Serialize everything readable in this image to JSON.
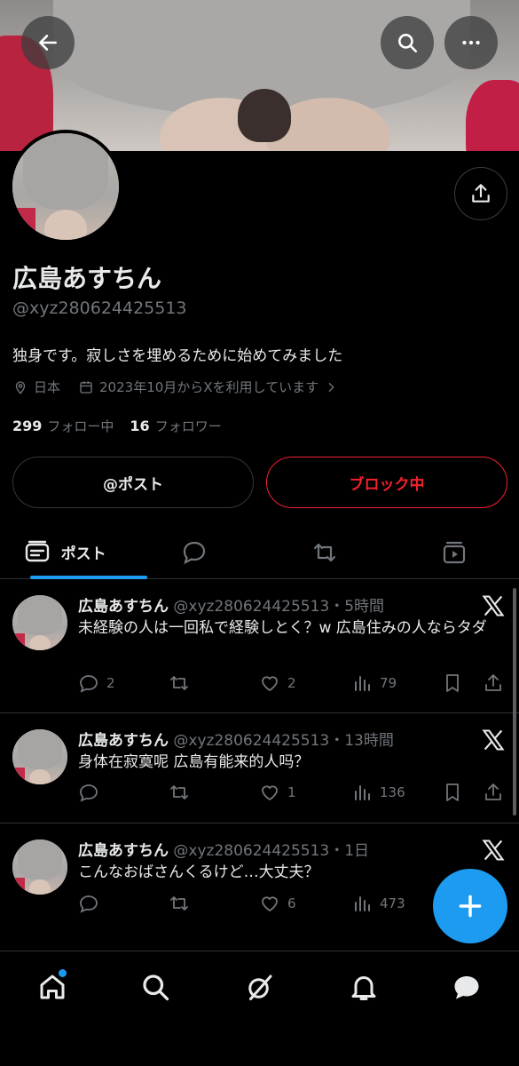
{
  "profile": {
    "name": "広島あすちん",
    "handle": "@xyz280624425513",
    "bio": "独身です。寂しさを埋めるために始めてみました",
    "location": "日本",
    "joined": "2023年10月からXを利用しています",
    "following_count": "299",
    "following_label": "フォロー中",
    "followers_count": "16",
    "followers_label": "フォロワー"
  },
  "buttons": {
    "post": "@ポスト",
    "block": "ブロック中"
  },
  "tabs": {
    "posts_label": "ポスト"
  },
  "posts": [
    {
      "name": "広島あすちん",
      "meta": "@xyz280624425513・5時間",
      "text": "未経験の人は一回私で経験しとく？w 広島住みの人ならタダ",
      "replies": "2",
      "likes": "2",
      "views": "79"
    },
    {
      "name": "広島あすちん",
      "meta": "@xyz280624425513・13時間",
      "text": "身体在寂寞呢 広島有能来的人吗？",
      "replies": "",
      "likes": "1",
      "views": "136"
    },
    {
      "name": "広島あすちん",
      "meta": "@xyz280624425513・1日",
      "text": "こんなおばさんくるけど…大丈夫？",
      "replies": "",
      "likes": "6",
      "views": "473"
    }
  ],
  "colors": {
    "accent": "#1d9bf0",
    "danger": "#f4212e",
    "muted": "#71767b",
    "text": "#e7e9ea",
    "background": "#000000"
  }
}
